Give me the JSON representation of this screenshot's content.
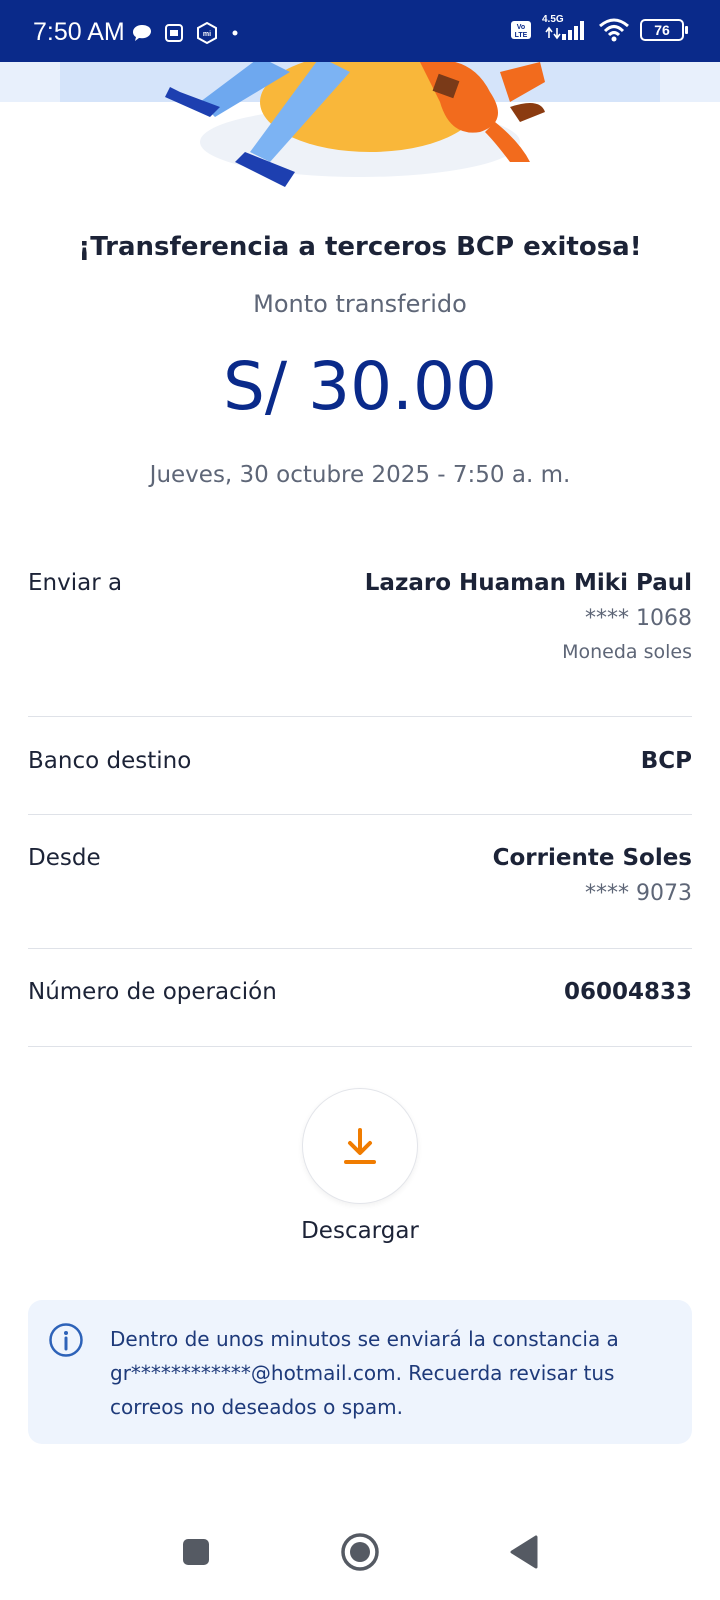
{
  "status_bar": {
    "time": "7:50 AM",
    "network": "4.5G",
    "volte": "Vo LTE",
    "battery": "76"
  },
  "receipt": {
    "title": "¡Transferencia a terceros BCP exitosa!",
    "subtitle": "Monto transferido",
    "amount": "S/ 30.00",
    "datetime": "Jueves, 30 octubre 2025 - 7:50 a. m."
  },
  "details": {
    "send_to": {
      "label": "Enviar a",
      "name": "Lazaro Huaman Miki Paul",
      "account": "**** 1068",
      "currency": "Moneda soles"
    },
    "bank": {
      "label": "Banco destino",
      "value": "BCP"
    },
    "from": {
      "label": "Desde",
      "value": "Corriente Soles",
      "account": "**** 9073"
    },
    "operation": {
      "label": "Número de operación",
      "value": "06004833"
    }
  },
  "download": {
    "label": "Descargar",
    "icon": "download-icon"
  },
  "info": {
    "icon": "info-icon",
    "text": "Dentro de unos minutos se enviará la constancia a gr************@hotmail.com. Recuerda revisar tus correos no deseados o spam."
  },
  "nav": {
    "recent": "recent-apps-icon",
    "home": "home-icon",
    "back": "back-icon"
  },
  "colors": {
    "brand_blue": "#0a2a8a",
    "accent_orange": "#f07c00",
    "text_dark": "#1c2337",
    "text_muted": "#5e6677",
    "info_bg": "#eef4fd"
  }
}
